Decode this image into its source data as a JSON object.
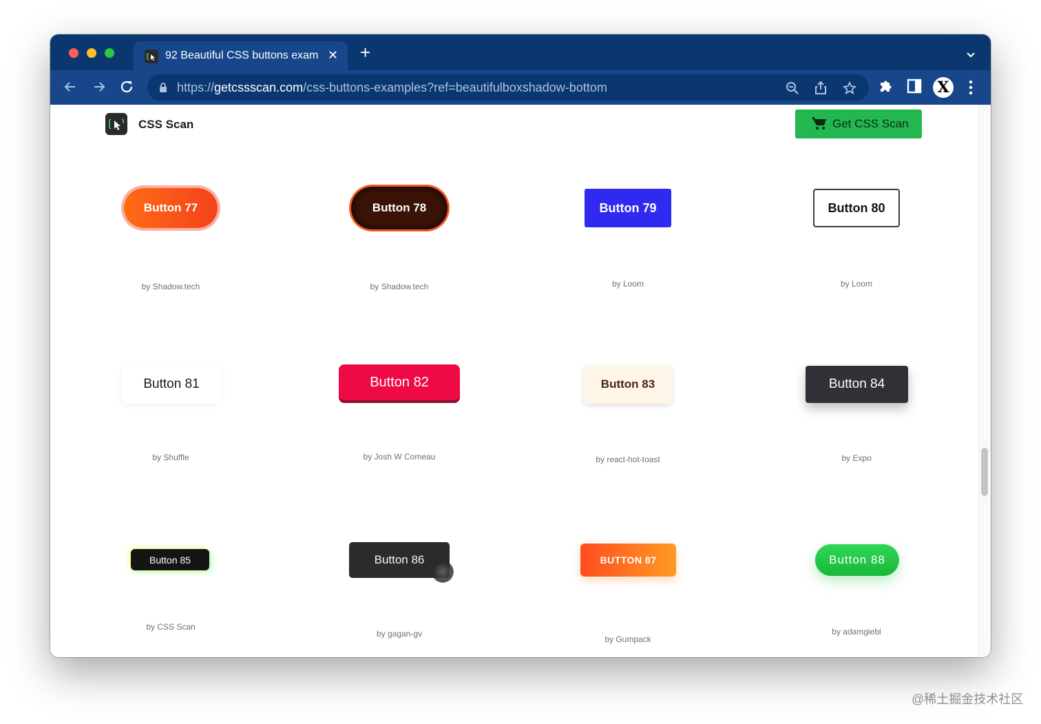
{
  "browser": {
    "tab_title": "92 Beautiful CSS buttons exam",
    "new_tab": "+",
    "url_scheme": "https://",
    "url_host": "getcssscan.com",
    "url_path": "/css-buttons-examples?ref=beautifulboxshadow-bottom",
    "profile_initial": "X"
  },
  "site": {
    "name": "CSS Scan",
    "cta_label": "Get CSS Scan",
    "cta_color": "#22b84f"
  },
  "buttons": [
    {
      "label": "Button 77",
      "credit": "by Shadow.tech"
    },
    {
      "label": "Button 78",
      "credit": "by Shadow.tech"
    },
    {
      "label": "Button 79",
      "credit": "by Loom"
    },
    {
      "label": "Button 80",
      "credit": "by Loom"
    },
    {
      "label": "Button 81",
      "credit": "by Shuffle"
    },
    {
      "label": "Button 82",
      "credit": "by Josh W Comeau"
    },
    {
      "label": "Button 83",
      "credit": "by react-hot-toast"
    },
    {
      "label": "Button 84",
      "credit": "by Expo"
    },
    {
      "label": "Button 85",
      "credit": "by CSS Scan"
    },
    {
      "label": "Button 86",
      "credit": "by gagan-gv"
    },
    {
      "label": "BUTTON 87",
      "credit": "by Gumpack"
    },
    {
      "label": "Button 88",
      "credit": "by adamgiebl"
    }
  ],
  "watermark": "@稀土掘金技术社区"
}
